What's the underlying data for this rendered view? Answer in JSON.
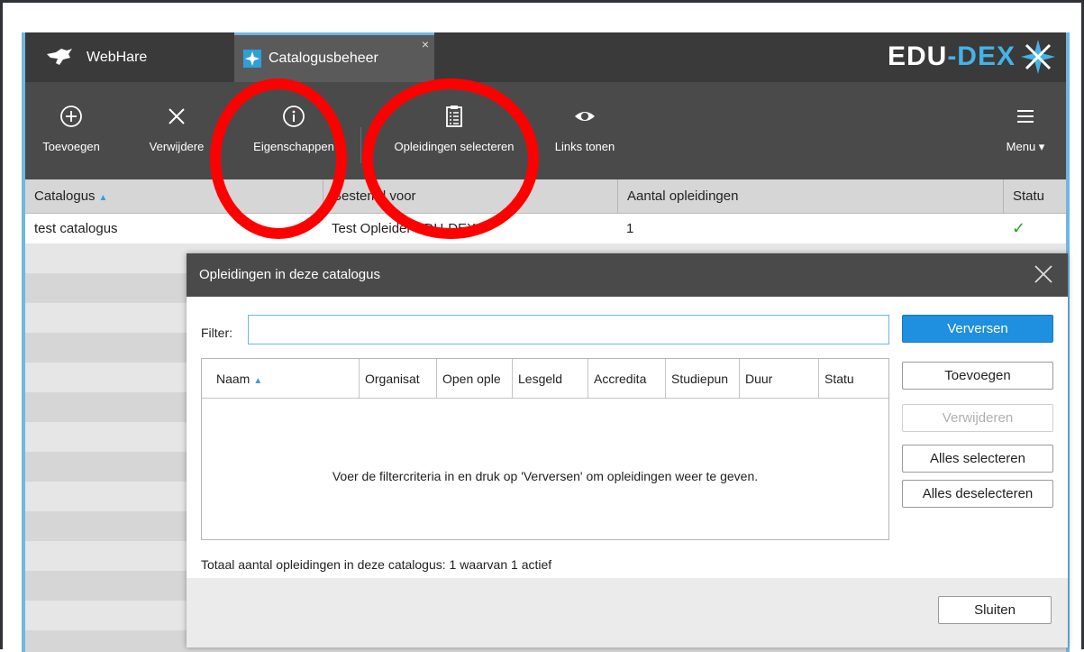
{
  "tabs": {
    "webhare": "WebHare",
    "catalogus": "Catalogusbeheer",
    "close": "×"
  },
  "brand": {
    "part1": "EDU",
    "part2": "-DEX"
  },
  "toolbar": {
    "add": "Toevoegen",
    "remove": "Verwijdere",
    "properties": "Eigenschappen",
    "select_courses": "Opleidingen selecteren",
    "show_links": "Links tonen",
    "menu": "Menu ▾"
  },
  "list": {
    "columns": [
      "Catalogus",
      "Bestemd voor",
      "Aantal opleidingen",
      "Statu"
    ],
    "sort_indicator": "▲",
    "rows": [
      {
        "catalogus": "test catalogus",
        "bestemd": "Test Opleider EDU-DEX",
        "aantal": "1",
        "status": "✓"
      }
    ]
  },
  "dialog": {
    "title": "Opleidingen in deze catalogus",
    "filter_label": "Filter:",
    "filter_value": "",
    "buttons": {
      "refresh": "Verversen",
      "add": "Toevoegen",
      "remove": "Verwijderen",
      "select_all": "Alles selecteren",
      "deselect_all": "Alles deselecteren",
      "close": "Sluiten"
    },
    "grid_columns": [
      "Naam",
      "Organisat",
      "Open ople",
      "Lesgeld",
      "Accredita",
      "Studiepun",
      "Duur",
      "Statu"
    ],
    "empty_message": "Voer de filtercriteria in en druk op 'Verversen' om opleidingen weer te geven.",
    "total": "Totaal aantal opleidingen in deze catalogus: 1 waarvan 1 actief"
  },
  "colors": {
    "accent": "#1f8fe0",
    "annotation": "#ff0000",
    "status_ok": "#2d9b2d"
  }
}
